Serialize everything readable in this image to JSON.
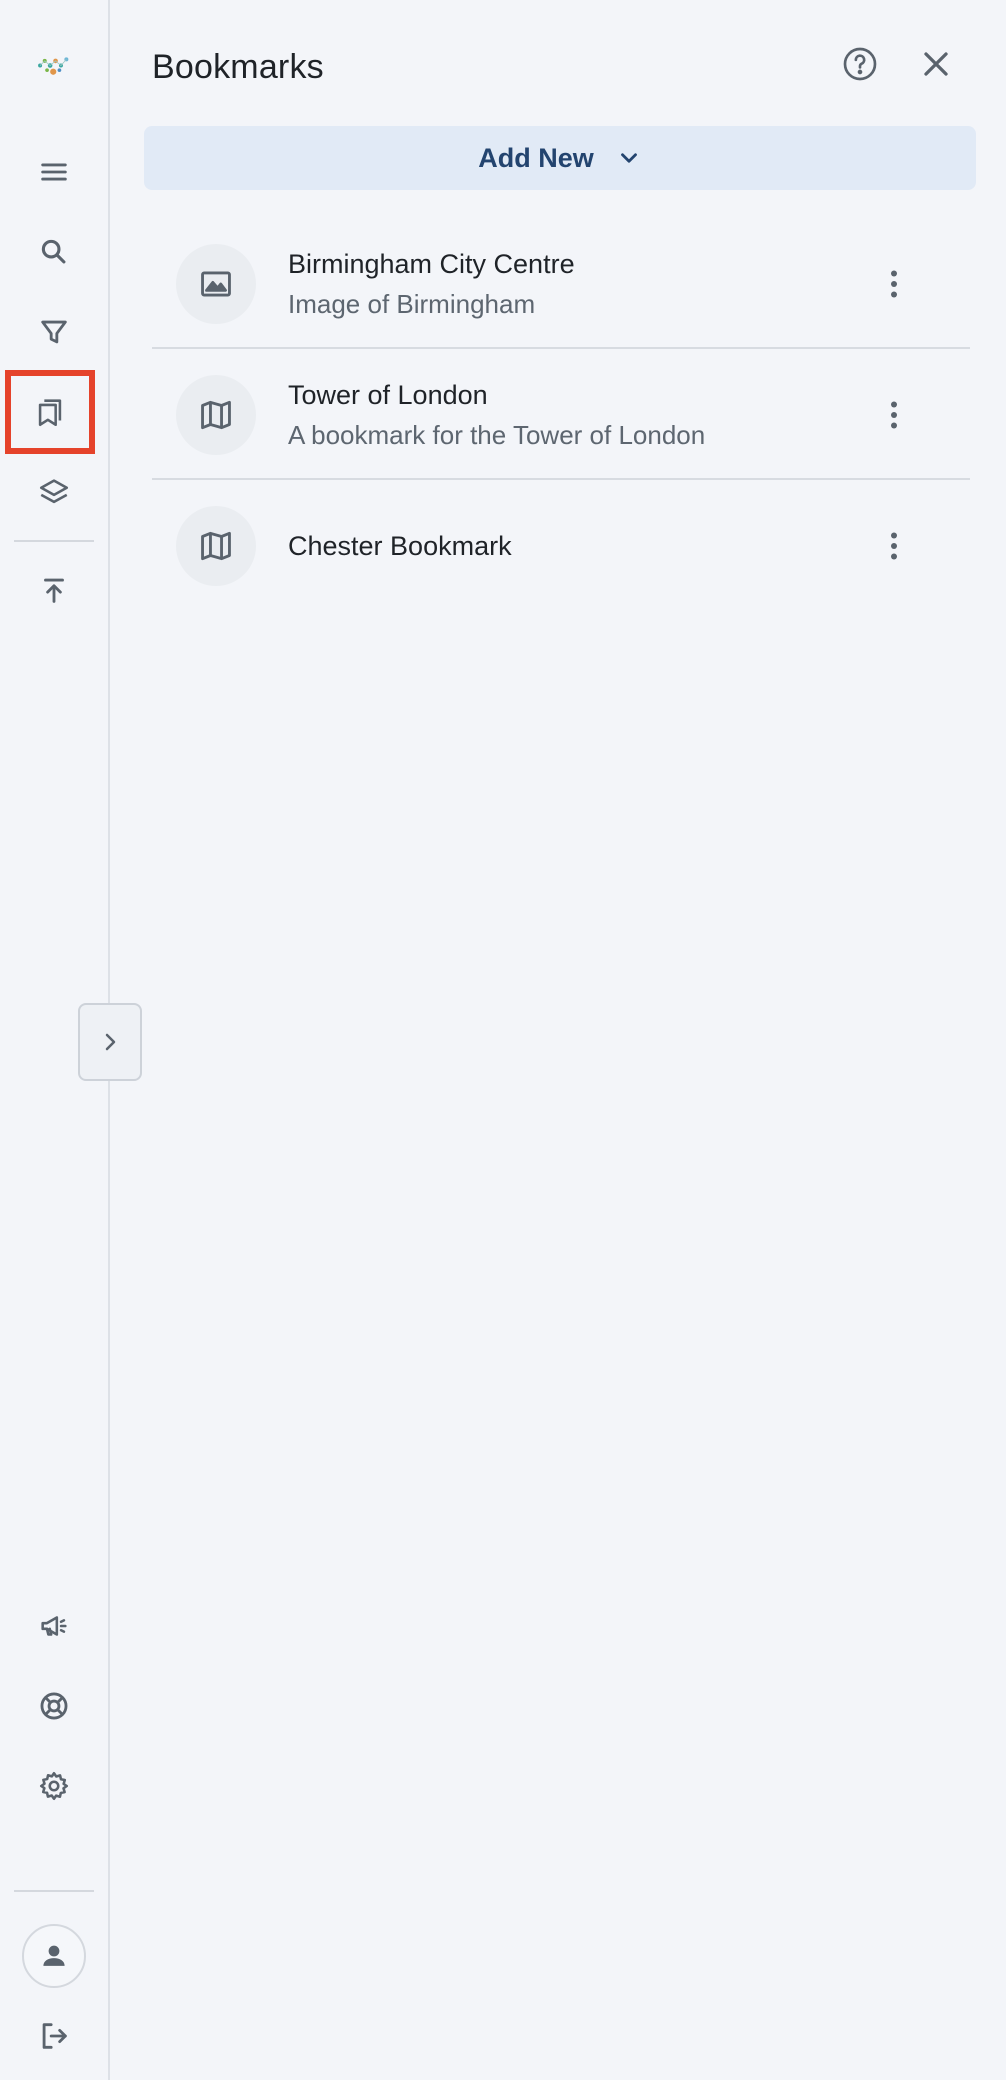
{
  "panel": {
    "title": "Bookmarks",
    "add_new_label": "Add New"
  },
  "rail": {
    "active_item": "bookmarks",
    "top_icons": [
      "logo-icon",
      "menu-icon",
      "search-icon",
      "filter-icon",
      "bookmarks-icon",
      "layers-icon",
      "export-icon"
    ],
    "bottom_icons": [
      "announcement-icon",
      "help-support-icon",
      "settings-icon",
      "account-icon",
      "logout-icon"
    ]
  },
  "bookmarks": [
    {
      "title": "Birmingham City Centre",
      "subtitle": "Image of Birmingham",
      "icon": "image-icon"
    },
    {
      "title": "Tower of London",
      "subtitle": "A bookmark for the Tower of London",
      "icon": "map-icon"
    },
    {
      "title": "Chester Bookmark",
      "subtitle": "",
      "icon": "map-icon"
    }
  ],
  "colors": {
    "background": "#f3f5f9",
    "accent_button_bg": "#e1eaf6",
    "accent_text": "#23446f",
    "active_highlight": "#e5432b",
    "icon_gray": "#5a636d"
  }
}
